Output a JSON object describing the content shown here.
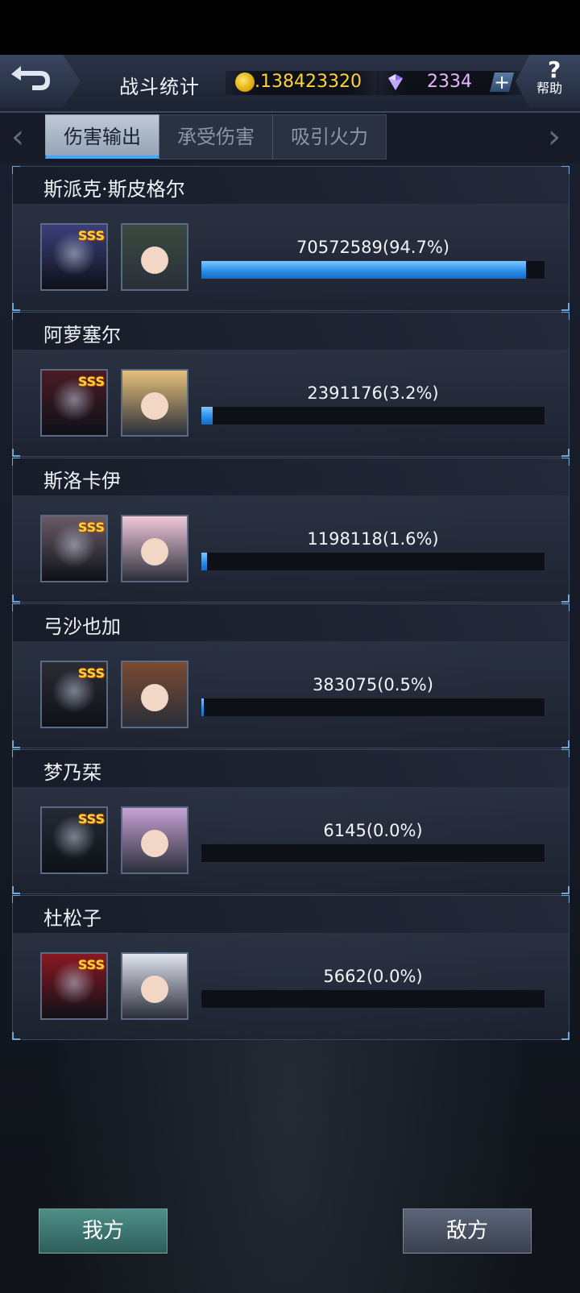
{
  "header": {
    "title": "战斗统计",
    "coins": ".138423320",
    "gems": "2334",
    "plus": "+",
    "help_icon": "?",
    "help_label": "帮助"
  },
  "tabs": [
    {
      "label": "伤害输出",
      "active": true
    },
    {
      "label": "承受伤害",
      "active": false
    },
    {
      "label": "吸引火力",
      "active": false
    }
  ],
  "nav": {
    "prev": "‹",
    "next": "›"
  },
  "rows": [
    {
      "name": "斯派克·斯皮格尔",
      "rank": "SSS",
      "value": "70572589(94.7%)",
      "fraction": 0.947,
      "mech_color": "#3b3f7a",
      "pilot_color": "#3a4a3f"
    },
    {
      "name": "阿萝塞尔",
      "rank": "SSS",
      "value": "2391176(3.2%)",
      "fraction": 0.032,
      "mech_color": "#4a1b24",
      "pilot_color": "#e7c17a"
    },
    {
      "name": "斯洛卡伊",
      "rank": "SSS",
      "value": "1198118(1.6%)",
      "fraction": 0.016,
      "mech_color": "#6a5b66",
      "pilot_color": "#f2c9da"
    },
    {
      "name": "弓沙也加",
      "rank": "SSS",
      "value": "383075(0.5%)",
      "fraction": 0.005,
      "mech_color": "#2b2b33",
      "pilot_color": "#7a4a30"
    },
    {
      "name": "梦乃栞",
      "rank": "SSS",
      "value": "6145(0.0%)",
      "fraction": 0.0,
      "mech_color": "#262a33",
      "pilot_color": "#c7a3d6"
    },
    {
      "name": "杜松子",
      "rank": "SSS",
      "value": "5662(0.0%)",
      "fraction": 0.0,
      "mech_color": "#8a1822",
      "pilot_color": "#dfe4ee"
    }
  ],
  "buttons": {
    "mine": "我方",
    "enemy": "敌方"
  },
  "colors": {
    "bar_fill": "#2c8fe6",
    "coin": "#ffd23a",
    "gem": "#e7b6ff"
  }
}
